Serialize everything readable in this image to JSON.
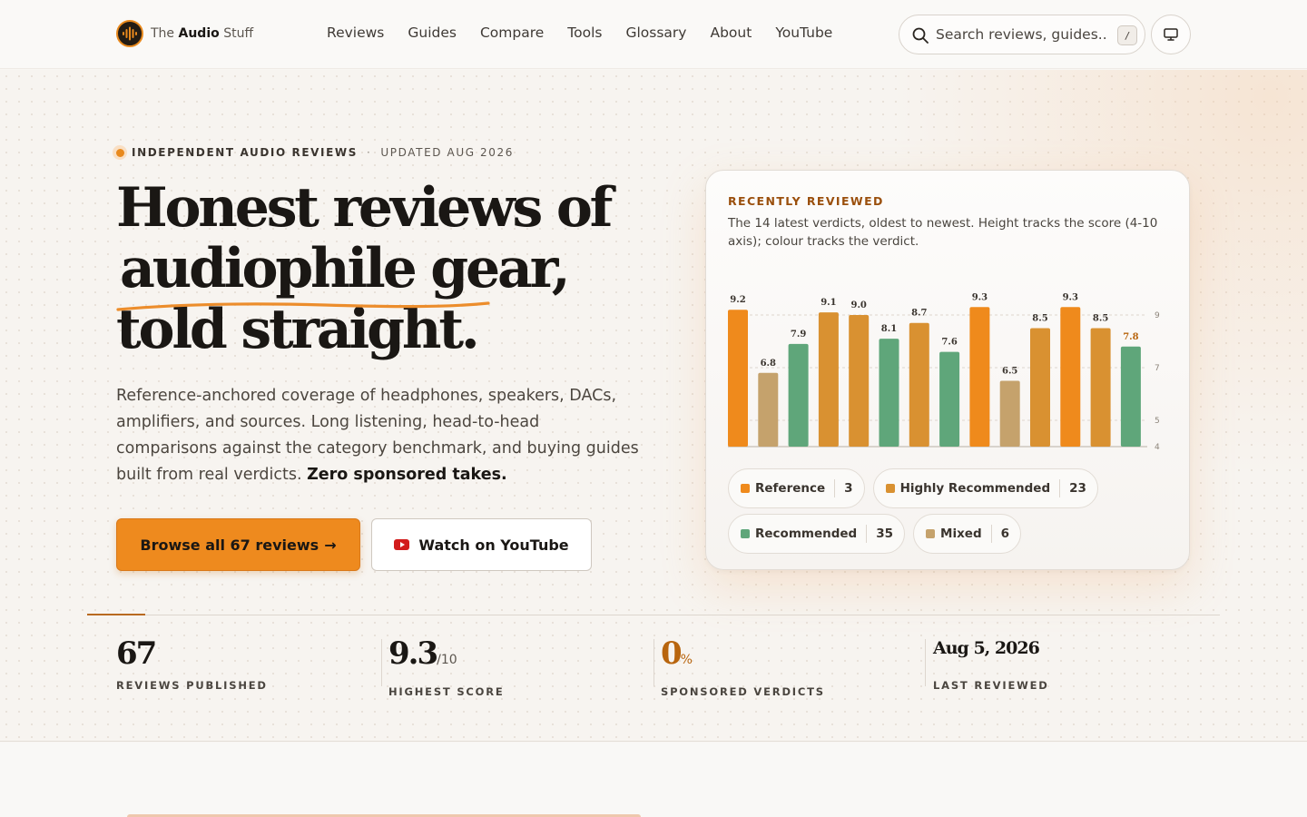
{
  "brand": {
    "prefix": "The",
    "name": "Audio",
    "suffix": "Stuff"
  },
  "nav": [
    "Reviews",
    "Guides",
    "Compare",
    "Tools",
    "Glossary",
    "About",
    "YouTube"
  ],
  "search": {
    "placeholder": "Search reviews, guides...",
    "shortcut": "/"
  },
  "hero": {
    "eyebrow": "INDEPENDENT AUDIO REVIEWS",
    "eyebrow_sep": "·",
    "updated": "UPDATED AUG 2026",
    "title_line1": "Honest reviews of",
    "title_highlight": "audiophile gear,",
    "title_line3": "told straight.",
    "lede": "Reference-anchored coverage of headphones, speakers, DACs, amplifiers, and sources. Long listening, head-to-head comparisons against the category benchmark, and buying guides built from real verdicts.",
    "lede_bold": "Zero sponsored takes.",
    "primary_cta": "Browse all 67 reviews",
    "primary_arrow": "→",
    "secondary_cta": "Watch on YouTube"
  },
  "card": {
    "eyebrow": "RECENTLY REVIEWED",
    "description": "The 14 latest verdicts, oldest to newest. Height tracks the score (4-10 axis); colour tracks the verdict."
  },
  "colors": {
    "Reference": "#ef8a1c",
    "Highly Recommended": "#d99131",
    "Recommended": "#5fa67a",
    "Mixed": "#c5a26c",
    "accent": "#ee8a1e"
  },
  "chart_data": {
    "type": "bar",
    "title": "",
    "xlabel": "",
    "ylabel": "",
    "ylim": [
      4,
      10
    ],
    "yticks": [
      4,
      5,
      7,
      9
    ],
    "grid": true,
    "values": [
      9.2,
      6.8,
      7.9,
      9.1,
      9.0,
      8.1,
      8.7,
      7.6,
      9.3,
      6.5,
      8.5,
      9.3,
      8.5,
      7.8
    ],
    "verdicts": [
      "Reference",
      "Mixed",
      "Recommended",
      "Highly Recommended",
      "Highly Recommended",
      "Recommended",
      "Highly Recommended",
      "Recommended",
      "Reference",
      "Mixed",
      "Highly Recommended",
      "Reference",
      "Highly Recommended",
      "Recommended"
    ],
    "highlight_last": true
  },
  "legend": [
    {
      "label": "Reference",
      "count": "3"
    },
    {
      "label": "Highly Recommended",
      "count": "23"
    },
    {
      "label": "Recommended",
      "count": "35"
    },
    {
      "label": "Mixed",
      "count": "6"
    }
  ],
  "stats": [
    {
      "value": "67",
      "unit": "",
      "label": "REVIEWS PUBLISHED"
    },
    {
      "value": "9.3",
      "unit": "/10",
      "label": "HIGHEST SCORE"
    },
    {
      "value": "0",
      "unit": "%",
      "label": "SPONSORED VERDICTS"
    },
    {
      "value": "Aug 5, 2026",
      "unit": "",
      "label": "LAST REVIEWED"
    }
  ]
}
